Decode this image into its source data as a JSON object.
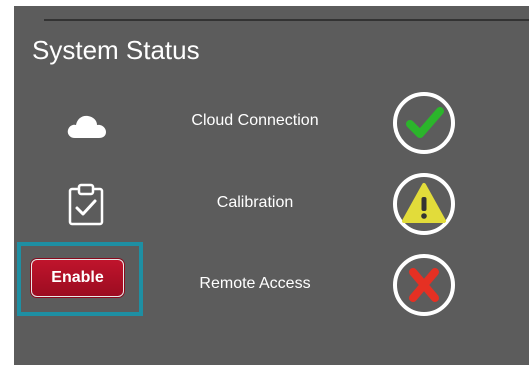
{
  "panel": {
    "title": "System Status"
  },
  "rows": [
    {
      "label": "Cloud Connection",
      "icon": "cloud-icon",
      "status": "ok",
      "status_icon": "check-icon",
      "status_color": "#2bb52b"
    },
    {
      "label": "Calibration",
      "icon": "clipboard-check-icon",
      "status": "warning",
      "status_icon": "warning-icon",
      "status_color": "#e2dc3a"
    },
    {
      "label": "Remote Access",
      "status": "error",
      "status_icon": "x-icon",
      "status_color": "#e53023"
    }
  ],
  "enable_button": {
    "label": "Enable",
    "color": "#b51129"
  },
  "colors": {
    "panel_background": "#5c5c5c",
    "highlight_frame": "#1e8fa3"
  }
}
